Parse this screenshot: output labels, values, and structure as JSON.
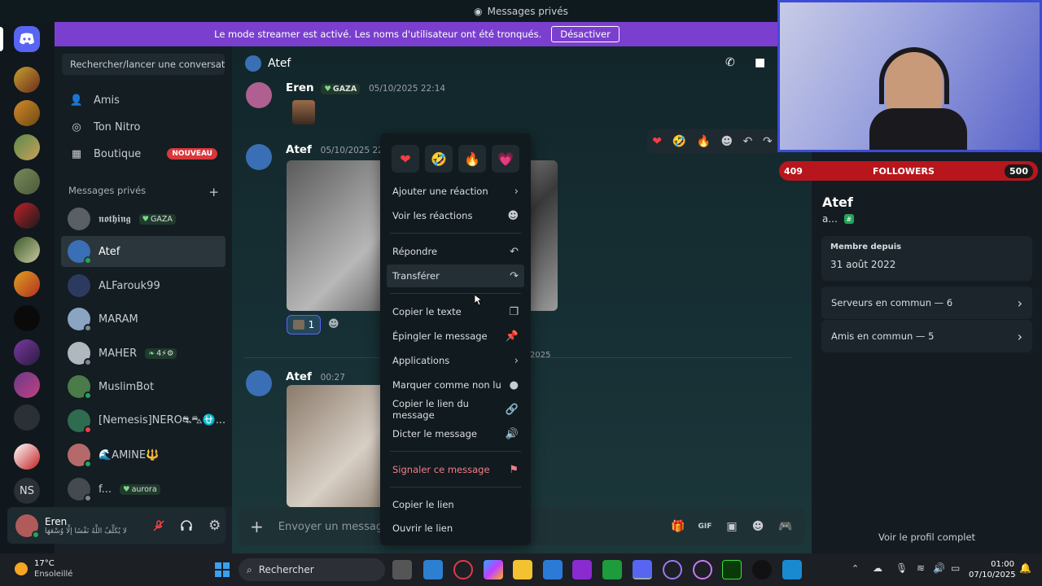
{
  "window": {
    "title": "Messages privés"
  },
  "banner": {
    "text": "Le mode streamer est activé. Les noms d'utilisateur ont été tronqués.",
    "button": "Désactiver"
  },
  "sidebar": {
    "search_placeholder": "Rechercher/lancer une conversati...",
    "nav": [
      {
        "label": "Amis",
        "icon": "friends-icon"
      },
      {
        "label": "Ton Nitro",
        "icon": "nitro-icon"
      },
      {
        "label": "Boutique",
        "icon": "shop-icon",
        "badge": "NOUVEAU"
      }
    ],
    "dm_header": "Messages privés",
    "dm_add": "+",
    "dms": [
      {
        "name": "𝖓𝖔𝖙𝖍𝖎𝖓𝖌",
        "tag": "GAZA",
        "color": "#5a5f66"
      },
      {
        "name": "Atef",
        "tag": "",
        "color": "#3a6fb5",
        "active": true,
        "status": "online"
      },
      {
        "name": "ALFarouk99",
        "tag": "",
        "color": "#2d3a60"
      },
      {
        "name": "MARAM",
        "tag": "",
        "color": "#8aa4c2",
        "status": "idle"
      },
      {
        "name": "MAHER",
        "tag": "4⚡⚙",
        "color": "#b0b7bf",
        "status": "idle"
      },
      {
        "name": "MuslimBot",
        "tag": "",
        "color": "#4a7b48",
        "status": "online"
      },
      {
        "name": "[Nemesis]NERO⛐⛍⛎...",
        "tag": "",
        "color": "#2f6b4f",
        "status": "dnd"
      },
      {
        "name": "🌊AMINE🔱",
        "tag": "",
        "color": "#b46a6a",
        "status": "online"
      },
      {
        "name": "f...",
        "tag": "aurora",
        "color": "#444a50",
        "status": "idle"
      }
    ]
  },
  "user_panel": {
    "name": "Eren",
    "status_text": "لا يُكَلِّفُ اللَّهُ نَفْسًا إِلَّا وُسْعَهَا"
  },
  "chat": {
    "header_name": "Atef",
    "messages": [
      {
        "author": "Eren",
        "tag": "GAZA",
        "time": "05/10/2025 22:14"
      },
      {
        "author": "Atef",
        "time": "05/10/2025 22:14",
        "reaction_count": "1"
      },
      {
        "author": "Atef",
        "time": "00:27"
      }
    ],
    "date_divider": "2025",
    "composer_placeholder": "Envoyer un message"
  },
  "hover_bar": {
    "emojis": [
      "❤",
      "🤣",
      "🔥"
    ]
  },
  "context_menu": {
    "reactions": [
      "❤",
      "🤣",
      "🔥",
      "💗"
    ],
    "items": [
      {
        "label": "Ajouter une réaction",
        "icon": "chevron-right-icon",
        "glyph": "›"
      },
      {
        "label": "Voir les réactions",
        "icon": "smile-icon",
        "glyph": "☻"
      },
      {
        "label": "Répondre",
        "icon": "reply-icon",
        "glyph": "↶"
      },
      {
        "label": "Transférer",
        "icon": "forward-icon",
        "glyph": "↷"
      },
      {
        "label": "Copier le texte",
        "icon": "copy-icon",
        "glyph": "❐"
      },
      {
        "label": "Épingler le message",
        "icon": "pin-icon",
        "glyph": "📌"
      },
      {
        "label": "Applications",
        "icon": "chevron-right-icon",
        "glyph": "›"
      },
      {
        "label": "Marquer comme non lu",
        "icon": "unread-icon",
        "glyph": "●"
      },
      {
        "label": "Copier le lien du message",
        "icon": "link-icon",
        "glyph": "🔗"
      },
      {
        "label": "Dicter le message",
        "icon": "speaker-icon",
        "glyph": "🔊"
      },
      {
        "label": "Signaler ce message",
        "icon": "flag-icon",
        "glyph": "⚑"
      },
      {
        "label": "Copier le lien",
        "icon": "none",
        "glyph": ""
      },
      {
        "label": "Ouvrir le lien",
        "icon": "none",
        "glyph": ""
      }
    ]
  },
  "profile": {
    "name": "Atef",
    "handle": "a...",
    "member_since_label": "Membre depuis",
    "member_since": "31 août 2022",
    "mutual_servers": "Serveurs en commun — 6",
    "mutual_friends": "Amis en commun — 5",
    "full_profile": "Voir le profil complet"
  },
  "overlay": {
    "followers_label": "FOLLOWERS",
    "current": "409",
    "goal": "500",
    "progress": 0.818
  },
  "taskbar": {
    "weather_temp": "17°C",
    "weather_text": "Ensoleillé",
    "search": "Rechercher",
    "time": "01:00",
    "date": "07/10/2025"
  },
  "colors": {
    "accent": "#5865f2",
    "banner": "#7b3fcf",
    "danger": "#f27e8b",
    "online": "#23a55a"
  }
}
